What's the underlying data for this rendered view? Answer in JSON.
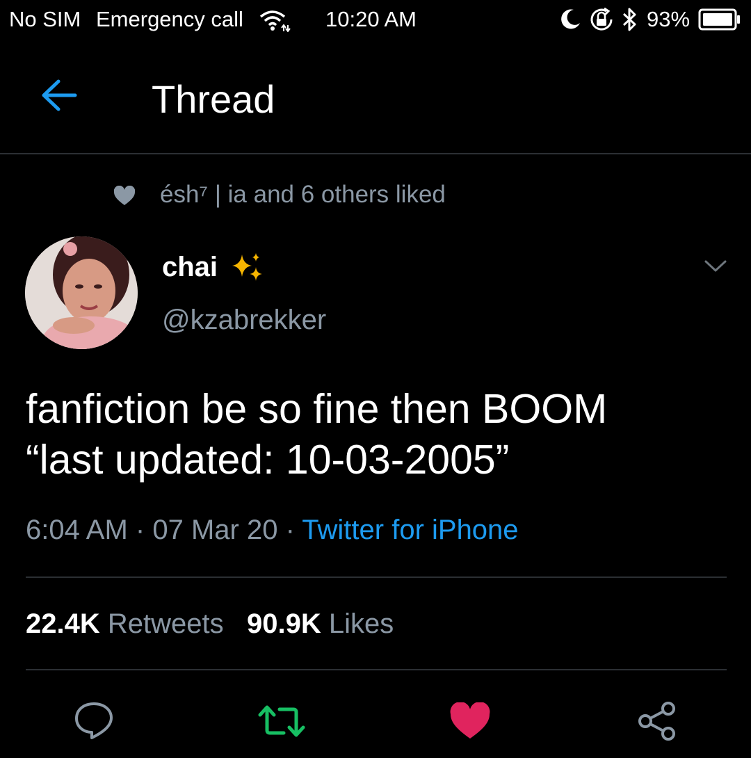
{
  "status_bar": {
    "carrier": "No SIM",
    "emergency": "Emergency call",
    "time": "10:20 AM",
    "battery": "93%",
    "icons": [
      "wifi-icon",
      "moon-icon",
      "rotation-lock-icon",
      "bluetooth-icon",
      "battery-icon"
    ]
  },
  "header": {
    "back_icon": "arrow-left-icon",
    "title": "Thread"
  },
  "social_context": {
    "icon": "heart-icon",
    "text": "ésh⁷ | ia and 6 others liked"
  },
  "author": {
    "name": "chai",
    "name_emoji": "sparkles-icon",
    "handle": "@kzabrekker",
    "menu_icon": "chevron-down-icon"
  },
  "tweet": {
    "line1": "fanfiction be so fine then BOOM",
    "line2": "“last updated: 10-03-2005”",
    "time": "6:04 AM",
    "date": "07 Mar 20",
    "source": "Twitter for iPhone",
    "separator": "·"
  },
  "stats": {
    "retweets_count": "22.4K",
    "retweets_label": "Retweets",
    "likes_count": "90.9K",
    "likes_label": "Likes"
  },
  "actions": {
    "reply_icon": "reply-icon",
    "retweet_icon": "retweet-icon",
    "like_icon": "heart-icon",
    "share_icon": "share-icon"
  },
  "colors": {
    "background": "#000000",
    "accent": "#1d9bf0",
    "secondary_text": "#8b98a5",
    "retweet_active": "#17bf63",
    "like_active": "#e0245e"
  }
}
